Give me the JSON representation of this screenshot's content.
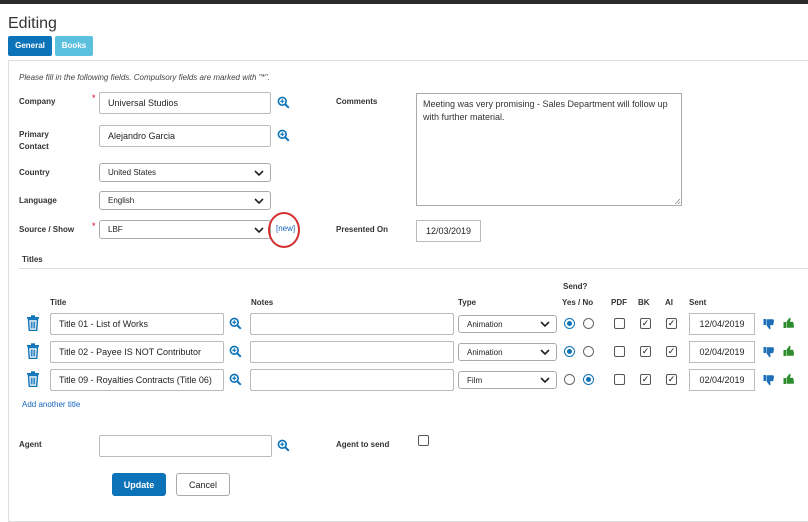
{
  "page": {
    "title": "Editing"
  },
  "tabs": [
    {
      "label": "General"
    },
    {
      "label": "Books"
    }
  ],
  "form": {
    "hint": "Please fill in the following fields. Compulsory fields are marked with \"*\".",
    "company": {
      "label": "Company",
      "value": "Universal Studios"
    },
    "primary_contact": {
      "label_line1": "Primary",
      "label_line2": "Contact",
      "value": "Alejandro Garcia"
    },
    "country": {
      "label": "Country",
      "value": "United States"
    },
    "language": {
      "label": "Language",
      "value": "English"
    },
    "source_show": {
      "label": "Source / Show",
      "value": "LBF",
      "new_link": "[new]"
    },
    "comments": {
      "label": "Comments",
      "value": "Meeting was very promising - Sales Department will follow up with further material."
    },
    "presented_on": {
      "label": "Presented On",
      "value": "12/03/2019"
    },
    "required_marker": "*"
  },
  "titles": {
    "section_label": "Titles",
    "headers": {
      "title": "Title",
      "notes": "Notes",
      "type": "Type",
      "send_line1": "Send?",
      "send_line2": "Yes / No",
      "pdf": "PDF",
      "bk": "BK",
      "ai": "AI",
      "sent": "Sent"
    },
    "rows": [
      {
        "title": "Title 01 - List of Works",
        "notes": "",
        "type": "Animation",
        "send": "yes",
        "pdf": false,
        "bk": true,
        "ai": true,
        "sent": "12/04/2019"
      },
      {
        "title": "Title 02 - Payee IS NOT Contributor",
        "notes": "",
        "type": "Animation",
        "send": "yes",
        "pdf": false,
        "bk": true,
        "ai": true,
        "sent": "02/04/2019"
      },
      {
        "title": "Title 09 - Royalties Contracts (Title 06)",
        "notes": "",
        "type": "Film",
        "send": "no",
        "pdf": false,
        "bk": true,
        "ai": true,
        "sent": "02/04/2019"
      }
    ],
    "add_link": "Add another title"
  },
  "agent": {
    "label": "Agent",
    "value": "",
    "agent_to_send_label": "Agent to send",
    "agent_to_send_checked": false
  },
  "buttons": {
    "update": "Update",
    "cancel": "Cancel"
  },
  "icons": {
    "search": "magnifier-plus-icon",
    "trash": "trash-icon",
    "thumb_down": "thumbs-down-icon",
    "thumb_up": "thumbs-up-icon",
    "chevron": "chevron-down-icon"
  },
  "colors": {
    "primary": "#0d73b9",
    "books_tab": "#5bc0de",
    "thumb_down": "#1e6fb8",
    "thumb_up": "#2e8b2e",
    "highlight_circle": "#d32f2f"
  }
}
